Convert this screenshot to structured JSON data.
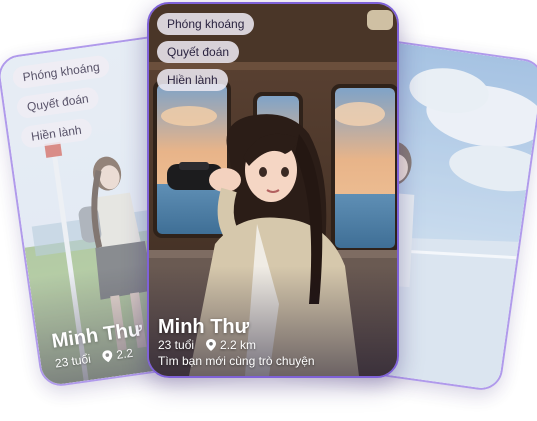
{
  "profile_center": {
    "tags": [
      "Phóng khoáng",
      "Quyết đoán",
      "Hiền lành"
    ],
    "name": "Minh Thư",
    "age": "23 tuổi",
    "distance": "2.2 km",
    "bio": "Tìm bạn mới cùng trò chuyện"
  },
  "profile_left": {
    "tags": [
      "Phóng khoáng",
      "Quyết đoán",
      "Hiền lành"
    ],
    "name": "Minh Thư",
    "age": "23 tuổi",
    "distance": "2.2"
  },
  "colors": {
    "card_border": "#7f62d8",
    "tag_bg": "#ece8f0",
    "tag_text": "#2a2340"
  },
  "icons": {
    "location": "map-pin-icon"
  }
}
